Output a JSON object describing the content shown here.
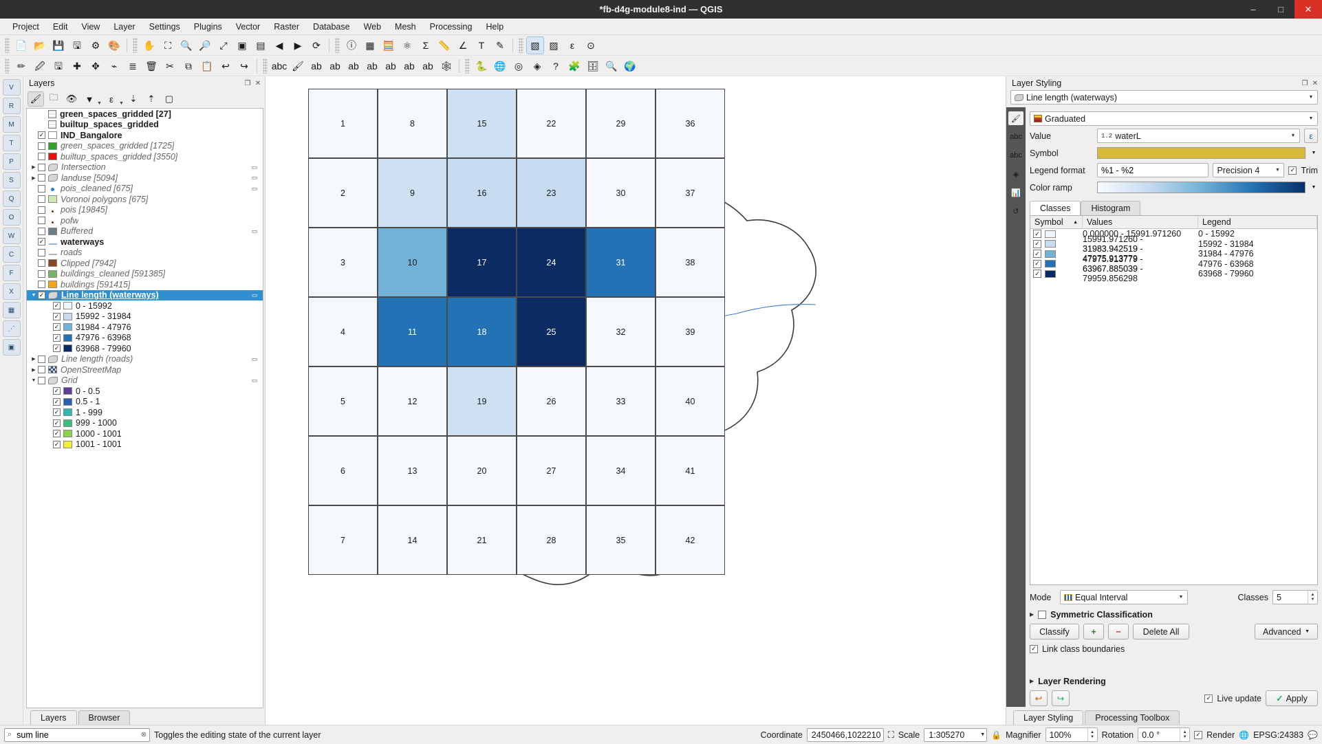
{
  "window": {
    "title": "*fb-d4g-module8-ind — QGIS",
    "minimize": "–",
    "maximize": "□",
    "close": "✕"
  },
  "menubar": [
    "Project",
    "Edit",
    "View",
    "Layer",
    "Settings",
    "Plugins",
    "Vector",
    "Raster",
    "Database",
    "Web",
    "Mesh",
    "Processing",
    "Help"
  ],
  "toolbar1": [
    "new-project-icon",
    "open-project-icon",
    "save-project-icon",
    "save-project-as-icon",
    "project-properties-icon",
    "style-manager-icon",
    "pan-map-icon",
    "pan-to-selection-icon",
    "zoom-in-icon",
    "zoom-out-icon",
    "zoom-full-icon",
    "zoom-selection-icon",
    "zoom-layer-icon",
    "zoom-last-icon",
    "zoom-next-icon",
    "refresh-icon",
    "identify-features-icon",
    "open-attribute-table-icon",
    "field-calculator-icon",
    "processing-toolbox-icon",
    "statistical-summary-icon",
    "measure-line-icon",
    "measure-angle-icon",
    "map-tips-icon",
    "text-annotation-icon",
    "select-features-icon",
    "deselect-icon",
    "select-by-expression-icon",
    "select-value-icon"
  ],
  "toolbar2": [
    "current-edits-icon",
    "toggle-editing-icon",
    "save-layer-edits-icon",
    "add-feature-icon",
    "move-feature-icon",
    "vertex-tool-icon",
    "modify-attributes-icon",
    "delete-selected-icon",
    "cut-features-icon",
    "copy-features-icon",
    "paste-features-icon",
    "undo-icon",
    "redo-icon",
    "label-abc-icon",
    "style-layer-icon",
    "single-label-icon",
    "highlight-label-icon",
    "pin-label-icon",
    "show-hide-label-icon",
    "move-label-icon",
    "rotate-label-icon",
    "change-label-icon",
    "spider-diagram-icon",
    "python-console-icon",
    "globe-web-icon",
    "georeferencer-icon",
    "metasearch-icon",
    "help-icon",
    "plugin-manager-icon",
    "db-manager-icon",
    "search-qms-icon",
    "qgis2web-icon"
  ],
  "left_vertical_toolbar": [
    "add-vector-layer-icon",
    "add-raster-layer-icon",
    "add-mesh-layer-icon",
    "add-delimited-text-icon",
    "add-postgis-icon",
    "add-spatialite-icon",
    "add-mssql-icon",
    "add-oracle-icon",
    "add-wms-icon",
    "add-wcs-icon",
    "add-wfs-icon",
    "add-xyz-icon",
    "add-vector-tile-icon",
    "add-point-cloud-icon",
    "new-shapefile-icon"
  ],
  "layers_panel": {
    "title": "Layers",
    "panel_buttons": [
      "float-panel-icon",
      "close-panel-icon"
    ],
    "toolbar": [
      "open-layer-styling-icon",
      "add-group-icon",
      "manage-map-themes-icon",
      "filter-legend-icon",
      "filter-legend-expression-icon",
      "expand-all-icon",
      "collapse-all-icon",
      "remove-layer-icon"
    ],
    "items": [
      {
        "label": "green_spaces_gridded [27]",
        "style": "bold",
        "icon": "table-icon",
        "checkbox": "none",
        "expander": false,
        "indent": 1
      },
      {
        "label": "builtup_spaces_gridded",
        "style": "bold",
        "icon": "table-icon",
        "checkbox": "none",
        "expander": false,
        "indent": 1
      },
      {
        "label": "IND_Bangalore",
        "style": "bold",
        "icon": "swatch",
        "color": "#ffffff",
        "checkbox": "checked",
        "expander": false,
        "indent": 1
      },
      {
        "label": "green_spaces_gridded [1725]",
        "style": "italic",
        "icon": "swatch",
        "color": "#33a02c",
        "checkbox": "unchecked",
        "expander": false,
        "indent": 1
      },
      {
        "label": "builtup_spaces_gridded [3550]",
        "style": "italic",
        "icon": "swatch",
        "color": "#e81010",
        "checkbox": "unchecked",
        "expander": false,
        "indent": 1
      },
      {
        "label": "Intersection",
        "style": "italic",
        "icon": "polygon-icon",
        "checkbox": "unchecked",
        "expander": true,
        "indent": 0,
        "badge": "edit-filter"
      },
      {
        "label": "landuse [5094]",
        "style": "italic",
        "icon": "polygon-icon",
        "checkbox": "unchecked",
        "expander": true,
        "indent": 0,
        "badge": "filter"
      },
      {
        "label": "pois_cleaned [675]",
        "style": "italic",
        "icon": "point-blue",
        "checkbox": "unchecked",
        "expander": false,
        "indent": 1,
        "badge": "edit-filter"
      },
      {
        "label": "Voronoi polygons [675]",
        "style": "italic",
        "icon": "swatch",
        "color": "#cdeab0",
        "checkbox": "unchecked",
        "expander": false,
        "indent": 1
      },
      {
        "label": "pois [19845]",
        "style": "italic",
        "icon": "point-dark",
        "checkbox": "unchecked",
        "expander": false,
        "indent": 1
      },
      {
        "label": "pofw",
        "style": "italic",
        "icon": "point-dark",
        "checkbox": "unchecked",
        "expander": false,
        "indent": 1
      },
      {
        "label": "Buffered",
        "style": "italic",
        "icon": "swatch",
        "color": "#6b7d85",
        "checkbox": "unchecked",
        "expander": false,
        "indent": 1,
        "badge": "filter"
      },
      {
        "label": "waterways",
        "style": "bold",
        "icon": "line-blue",
        "checkbox": "checked",
        "expander": false,
        "indent": 1
      },
      {
        "label": "roads",
        "style": "italic",
        "icon": "line-grey",
        "checkbox": "unchecked",
        "expander": false,
        "indent": 1
      },
      {
        "label": "Clipped [7942]",
        "style": "italic",
        "icon": "swatch",
        "color": "#8a4726",
        "checkbox": "unchecked",
        "expander": false,
        "indent": 1
      },
      {
        "label": "buildings_cleaned [591385]",
        "style": "italic",
        "icon": "swatch",
        "color": "#7cb36b",
        "checkbox": "unchecked",
        "expander": false,
        "indent": 1
      },
      {
        "label": "buildings [591415]",
        "style": "italic",
        "icon": "swatch",
        "color": "#f5a31a",
        "checkbox": "unchecked",
        "expander": false,
        "indent": 1
      },
      {
        "label": "Line length (waterways)",
        "style": "bold-underline",
        "icon": "polygon-icon",
        "checkbox": "checked",
        "expander": "down",
        "indent": 0,
        "selected": true,
        "badge": "edit-filter"
      },
      {
        "label": "0 - 15992",
        "style": "normal",
        "icon": "swatch",
        "color": "#eff3fb",
        "checkbox": "checked",
        "expander": false,
        "indent": 2
      },
      {
        "label": "15992 - 31984",
        "style": "normal",
        "icon": "swatch",
        "color": "#c6dbef",
        "checkbox": "checked",
        "expander": false,
        "indent": 2
      },
      {
        "label": "31984 - 47976",
        "style": "normal",
        "icon": "swatch",
        "color": "#72b2d7",
        "checkbox": "checked",
        "expander": false,
        "indent": 2
      },
      {
        "label": "47976 - 63968",
        "style": "normal",
        "icon": "swatch",
        "color": "#2272b5",
        "checkbox": "checked",
        "expander": false,
        "indent": 2
      },
      {
        "label": "63968 - 79960",
        "style": "normal",
        "icon": "swatch",
        "color": "#0b2c63",
        "checkbox": "checked",
        "expander": false,
        "indent": 2
      },
      {
        "label": "Line length (roads)",
        "style": "italic",
        "icon": "polygon-icon",
        "checkbox": "unchecked",
        "expander": true,
        "indent": 0,
        "badge": "filter"
      },
      {
        "label": "OpenStreetMap",
        "style": "italic",
        "icon": "raster-icon",
        "checkbox": "unchecked",
        "expander": true,
        "indent": 0
      },
      {
        "label": "Grid",
        "style": "italic",
        "icon": "polygon-icon",
        "checkbox": "unchecked",
        "expander": "down",
        "indent": 0,
        "badge": "filter"
      },
      {
        "label": "0 - 0.5",
        "style": "normal",
        "icon": "swatch",
        "color": "#5e3c99",
        "checkbox": "checked",
        "expander": false,
        "indent": 2
      },
      {
        "label": "0.5 - 1",
        "style": "normal",
        "icon": "swatch",
        "color": "#2b5fb0",
        "checkbox": "checked",
        "expander": false,
        "indent": 2
      },
      {
        "label": "1 - 999",
        "style": "normal",
        "icon": "swatch",
        "color": "#30b7ae",
        "checkbox": "checked",
        "expander": false,
        "indent": 2
      },
      {
        "label": "999 - 1000",
        "style": "normal",
        "icon": "swatch",
        "color": "#3cbf7c",
        "checkbox": "checked",
        "expander": false,
        "indent": 2
      },
      {
        "label": "1000 - 1001",
        "style": "normal",
        "icon": "swatch",
        "color": "#8cd24a",
        "checkbox": "checked",
        "expander": false,
        "indent": 2
      },
      {
        "label": "1001 - 1001",
        "style": "normal",
        "icon": "swatch",
        "color": "#f3ec3a",
        "checkbox": "checked",
        "expander": false,
        "indent": 2
      }
    ],
    "tabs": [
      {
        "label": "Layers",
        "active": true
      },
      {
        "label": "Browser",
        "active": false
      }
    ]
  },
  "style_panel": {
    "title": "Layer Styling",
    "layer_combo": "Line length (waterways)",
    "renderer_combo": "Graduated",
    "labels": {
      "value": "Value",
      "symbol": "Symbol",
      "legend_format": "Legend format",
      "color_ramp": "Color ramp",
      "precision": "Precision 4",
      "trim": "Trim",
      "mode": "Mode",
      "classes": "Classes"
    },
    "value_field": "waterL",
    "value_field_prefix": "1.2",
    "legend_format": "%1 - %2",
    "precision": "Precision 4",
    "trim_checked": true,
    "symbol_color": "#d9b93a",
    "side_tabs": [
      "symbology-icon",
      "labels-icon",
      "masks-icon",
      "3d-view-icon",
      "diagrams-icon",
      "history-icon"
    ],
    "tabs": [
      {
        "label": "Classes",
        "active": true
      },
      {
        "label": "Histogram",
        "active": false
      }
    ],
    "table_headers": {
      "symbol": "Symbol",
      "values": "Values",
      "legend": "Legend"
    },
    "classes": [
      {
        "checked": true,
        "color": "#eff3fb",
        "values": "0.000000 - 15991.971260",
        "legend": "0 - 15992"
      },
      {
        "checked": true,
        "color": "#c6dbef",
        "values": "15991.971260 - 31983.942519",
        "legend": "15992 - 31984"
      },
      {
        "checked": true,
        "color": "#72b2d7",
        "values": "31983.942519 - 47975.913779",
        "legend": "31984 - 47976"
      },
      {
        "checked": true,
        "color": "#2272b5",
        "values": "47975.913779 - 63967.885039",
        "legend": "47976 - 63968"
      },
      {
        "checked": true,
        "color": "#0b2c63",
        "values": "63967.885039 - 79959.856298",
        "legend": "63968 - 79960"
      }
    ],
    "mode": "Equal Interval",
    "classes_count": "5",
    "symmetric_classification": "Symmetric Classification",
    "symmetric_checked": false,
    "buttons": {
      "classify": "Classify",
      "add": "+",
      "remove": "−",
      "delete_all": "Delete All",
      "advanced": "Advanced"
    },
    "link_class_boundaries": "Link class boundaries",
    "link_checked": true,
    "layer_rendering": "Layer Rendering",
    "live_update": "Live update",
    "live_update_checked": true,
    "apply": "Apply",
    "bottom_tabs": [
      {
        "label": "Layer Styling",
        "active": true
      },
      {
        "label": "Processing Toolbox",
        "active": false
      }
    ]
  },
  "statusbar": {
    "search_value": "sum line",
    "search_placeholder": "Search",
    "hint": "Toggles the editing state of the current layer",
    "coordinate_label": "Coordinate",
    "coordinate_value": "2450466,1022210",
    "scale_label": "Scale",
    "scale_value": "1:305270",
    "magnifier_label": "Magnifier",
    "magnifier_value": "100%",
    "rotation_label": "Rotation",
    "rotation_value": "0.0 °",
    "render_label": "Render",
    "render_checked": true,
    "crs": "EPSG:24383"
  },
  "map": {
    "cells": [
      {
        "n": "1",
        "col": 0,
        "row": 0,
        "fill": "#f5f9fe"
      },
      {
        "n": "8",
        "col": 1,
        "row": 0,
        "fill": "#f5f9fe"
      },
      {
        "n": "15",
        "col": 2,
        "row": 0,
        "fill": "#cfe0f2"
      },
      {
        "n": "22",
        "col": 3,
        "row": 0,
        "fill": "#f5f9fe"
      },
      {
        "n": "29",
        "col": 4,
        "row": 0,
        "fill": "#f5f9fe"
      },
      {
        "n": "36",
        "col": 5,
        "row": 0,
        "fill": "#f5f9fe"
      },
      {
        "n": "2",
        "col": 0,
        "row": 1,
        "fill": "#f5f9fe"
      },
      {
        "n": "9",
        "col": 1,
        "row": 1,
        "fill": "#cfe0f2"
      },
      {
        "n": "16",
        "col": 2,
        "row": 1,
        "fill": "#c6dbef"
      },
      {
        "n": "23",
        "col": 3,
        "row": 1,
        "fill": "#c6dbef"
      },
      {
        "n": "30",
        "col": 4,
        "row": 1,
        "fill": "#f5f9fe"
      },
      {
        "n": "37",
        "col": 5,
        "row": 1,
        "fill": "#f5f9fe"
      },
      {
        "n": "3",
        "col": 0,
        "row": 2,
        "fill": "#f5f9fe"
      },
      {
        "n": "10",
        "col": 1,
        "row": 2,
        "fill": "#72b2d7"
      },
      {
        "n": "17",
        "col": 2,
        "row": 2,
        "fill": "#0b2c63",
        "light": true
      },
      {
        "n": "24",
        "col": 3,
        "row": 2,
        "fill": "#0b2c63",
        "light": true
      },
      {
        "n": "31",
        "col": 4,
        "row": 2,
        "fill": "#2272b5",
        "light": true
      },
      {
        "n": "38",
        "col": 5,
        "row": 2,
        "fill": "#f5f9fe"
      },
      {
        "n": "4",
        "col": 0,
        "row": 3,
        "fill": "#f5f9fe"
      },
      {
        "n": "11",
        "col": 1,
        "row": 3,
        "fill": "#2272b5",
        "light": true
      },
      {
        "n": "18",
        "col": 2,
        "row": 3,
        "fill": "#2272b5",
        "light": true
      },
      {
        "n": "25",
        "col": 3,
        "row": 3,
        "fill": "#0b2c63",
        "light": true
      },
      {
        "n": "32",
        "col": 4,
        "row": 3,
        "fill": "#f5f9fe"
      },
      {
        "n": "39",
        "col": 5,
        "row": 3,
        "fill": "#f5f9fe"
      },
      {
        "n": "5",
        "col": 0,
        "row": 4,
        "fill": "#f5f9fe"
      },
      {
        "n": "12",
        "col": 1,
        "row": 4,
        "fill": "#f5f9fe"
      },
      {
        "n": "19",
        "col": 2,
        "row": 4,
        "fill": "#cfe0f2"
      },
      {
        "n": "26",
        "col": 3,
        "row": 4,
        "fill": "#f5f9fe"
      },
      {
        "n": "33",
        "col": 4,
        "row": 4,
        "fill": "#f5f9fe"
      },
      {
        "n": "40",
        "col": 5,
        "row": 4,
        "fill": "#f5f9fe"
      },
      {
        "n": "6",
        "col": 0,
        "row": 5,
        "fill": "#f5f9fe"
      },
      {
        "n": "13",
        "col": 1,
        "row": 5,
        "fill": "#f5f9fe"
      },
      {
        "n": "20",
        "col": 2,
        "row": 5,
        "fill": "#f5f9fe"
      },
      {
        "n": "27",
        "col": 3,
        "row": 5,
        "fill": "#f5f9fe"
      },
      {
        "n": "34",
        "col": 4,
        "row": 5,
        "fill": "#f5f9fe"
      },
      {
        "n": "41",
        "col": 5,
        "row": 5,
        "fill": "#f5f9fe"
      },
      {
        "n": "7",
        "col": 0,
        "row": 6,
        "fill": "#f5f9fe"
      },
      {
        "n": "14",
        "col": 1,
        "row": 6,
        "fill": "#f5f9fe"
      },
      {
        "n": "21",
        "col": 2,
        "row": 6,
        "fill": "#f5f9fe"
      },
      {
        "n": "28",
        "col": 3,
        "row": 6,
        "fill": "#f5f9fe"
      },
      {
        "n": "35",
        "col": 4,
        "row": 6,
        "fill": "#f5f9fe"
      },
      {
        "n": "42",
        "col": 5,
        "row": 6,
        "fill": "#f5f9fe"
      }
    ]
  }
}
